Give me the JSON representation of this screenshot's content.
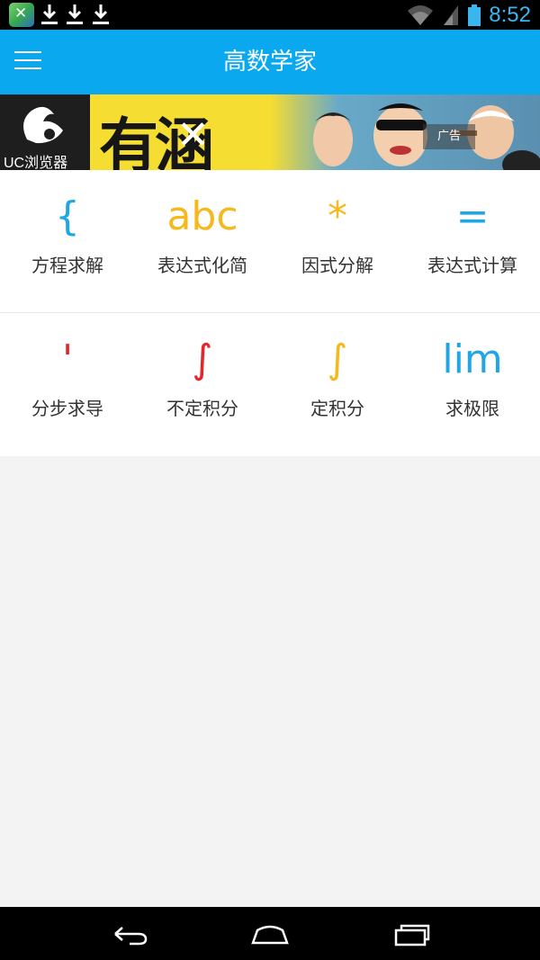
{
  "status_bar": {
    "time": "8:52",
    "icons": [
      "app-notification-icon",
      "download-icon",
      "download-icon",
      "download-icon",
      "wifi-icon",
      "signal-icon",
      "battery-icon"
    ]
  },
  "app_bar": {
    "title": "高数学家",
    "menu_icon": "menu-icon"
  },
  "ad": {
    "logo_text": "UC浏览器",
    "headline": "有涵",
    "headline_x": "✕",
    "label": "广告"
  },
  "tools": {
    "row1": [
      {
        "symbol": "{",
        "label": "方程求解",
        "color": "#1fa6e6"
      },
      {
        "symbol": "abc",
        "label": "表达式化简",
        "color": "#f6b81c"
      },
      {
        "symbol": "*",
        "label": "因式分解",
        "color": "#f6b81c"
      },
      {
        "symbol": "=",
        "label": "表达式计算",
        "color": "#1fa6e6"
      }
    ],
    "row2": [
      {
        "symbol": "'",
        "label": "分步求导",
        "color": "#e8242b"
      },
      {
        "symbol": "∫",
        "label": "不定积分",
        "color": "#e8242b"
      },
      {
        "symbol": "∫",
        "label": "定积分",
        "color": "#f6b81c"
      },
      {
        "symbol": "lim",
        "label": "求极限",
        "color": "#1fa6e6"
      }
    ]
  },
  "nav_bar": {
    "icons": [
      "back-icon",
      "home-icon",
      "recent-apps-icon"
    ]
  }
}
